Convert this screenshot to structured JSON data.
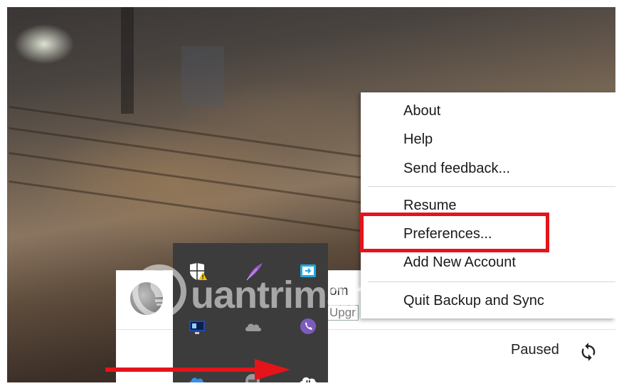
{
  "context_menu": {
    "items_group1": [
      "About",
      "Help",
      "Send feedback..."
    ],
    "items_group2": [
      "Resume",
      "Preferences...",
      "Add New Account"
    ],
    "items_group3": [
      "Quit Backup and Sync"
    ]
  },
  "backup_panel": {
    "email_fragment": "om",
    "upgrade_fragment": "Upgr",
    "status": "Paused"
  },
  "watermark": {
    "text": "uantrimang"
  },
  "tray_icons": [
    "windows-security-warning-icon",
    "quill-icon",
    "remote-desktop-icon",
    "monitor-icon",
    "cloud-icon",
    "viber-icon",
    "onedrive-icon",
    "gray-app-icon",
    "backup-and-sync-icon"
  ],
  "colors": {
    "highlight": "#e4141a",
    "arrow": "#e4141a",
    "tray_bg": "#3c3c3c"
  }
}
